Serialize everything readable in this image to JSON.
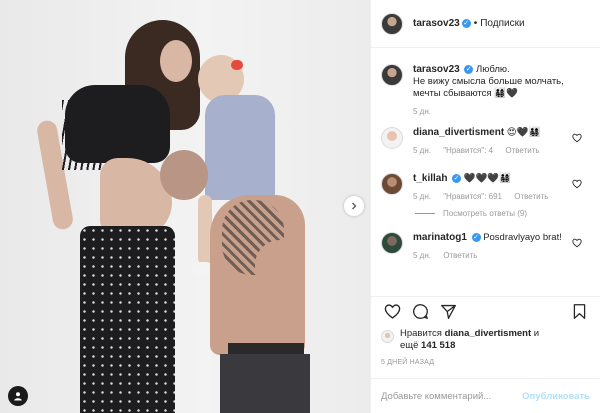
{
  "header": {
    "username": "tarasov23",
    "separator": "•",
    "follow_label": "Подписки"
  },
  "caption": {
    "username": "tarasov23",
    "text": "Люблю.\nНе вижу смысла больше молчать, мечты сбываются 👨‍👩‍👧‍👦🖤",
    "time": "5 дн."
  },
  "comments": [
    {
      "username": "diana_divertisment",
      "text": "😍🖤👨‍👩‍👧‍👦",
      "time": "5 дн.",
      "likes": "\"Нравится\": 4",
      "reply_label": "Ответить"
    },
    {
      "username": "t_killah",
      "text": "🖤🖤🖤👨‍👩‍👧‍👦",
      "time": "5 дн.",
      "likes": "\"Нравится\": 691",
      "reply_label": "Ответить",
      "view_replies": "Посмотреть ответы (9)"
    },
    {
      "username": "marinatog1",
      "text": "Posdravlyayo brat!",
      "time": "5 дн.",
      "likes": "",
      "reply_label": "Ответить"
    }
  ],
  "likes": {
    "prefix": "Нравится",
    "user": "diana_divertisment",
    "middle": "и",
    "more": "ещё",
    "count": "141 518"
  },
  "post_date": "5 ДНЕЙ НАЗАД",
  "add_comment": {
    "placeholder": "Добавьте комментарий...",
    "publish_label": "Опубликовать"
  },
  "icons": {
    "verified": "verified-badge-icon",
    "like": "heart-icon",
    "comment": "comment-icon",
    "share": "share-icon",
    "save": "bookmark-icon",
    "next": "chevron-right-icon",
    "user_tag": "person-icon"
  },
  "colors": {
    "accent": "#3897f0",
    "publish_disabled": "#b2dffc",
    "muted": "#999999",
    "text": "#262626"
  }
}
